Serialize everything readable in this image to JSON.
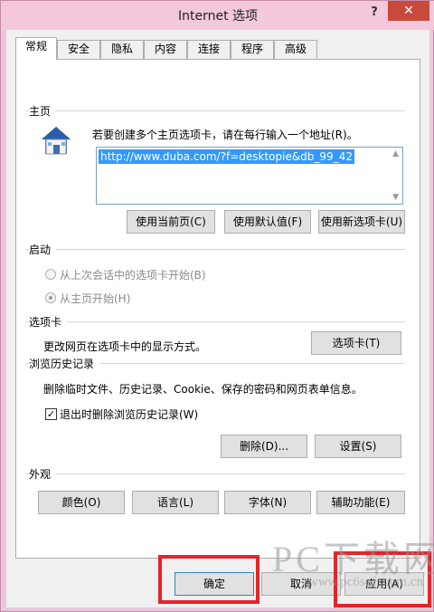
{
  "window": {
    "title": "Internet 选项",
    "help": "?",
    "close": "✕"
  },
  "tabs": [
    "常规",
    "安全",
    "隐私",
    "内容",
    "连接",
    "程序",
    "高级"
  ],
  "homepage": {
    "section": "主页",
    "description": "若要创建多个主页选项卡，请在每行输入一个地址(R)。",
    "url": "http://www.duba.com/?f=desktopie&db_99_42",
    "btn_current": "使用当前页(C)",
    "btn_default": "使用默认值(F)",
    "btn_new_tab": "使用新选项卡(U)"
  },
  "startup": {
    "section": "启动",
    "option_last_session": "从上次会话中的选项卡开始(B)",
    "option_homepage": "从主页开始(H)"
  },
  "tabs_section": {
    "section": "选项卡",
    "description": "更改网页在选项卡中的显示方式。",
    "button": "选项卡(T)"
  },
  "history": {
    "section": "浏览历史记录",
    "description": "删除临时文件、历史记录、Cookie、保存的密码和网页表单信息。",
    "checkbox_label": "退出时删除浏览历史记录(W)",
    "btn_delete": "删除(D)...",
    "btn_settings": "设置(S)"
  },
  "appearance": {
    "section": "外观",
    "btn_colors": "颜色(O)",
    "btn_languages": "语言(L)",
    "btn_fonts": "字体(N)",
    "btn_accessibility": "辅助功能(E)"
  },
  "footer": {
    "ok": "确定",
    "cancel": "取消",
    "apply": "应用(A)"
  },
  "watermark": {
    "line1": "PC下载网",
    "line2": "www.pc6soft.com.cn"
  },
  "colors": {
    "highlight": "#e5242b",
    "selection": "#3399ff",
    "title_bg": "#f2c8da",
    "close_bg": "#c74a3c"
  }
}
